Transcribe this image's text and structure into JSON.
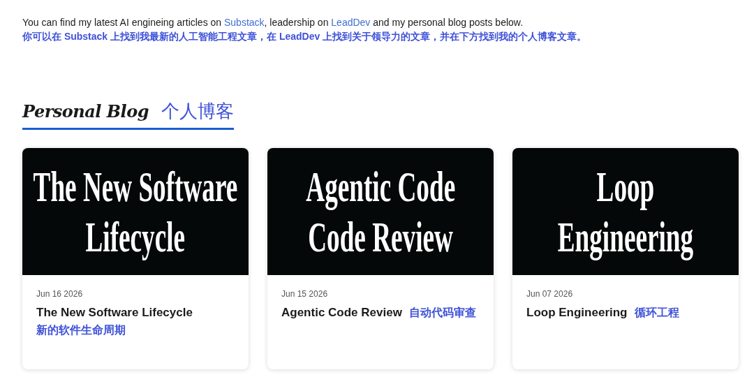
{
  "intro": {
    "parts": [
      {
        "text": "You can find my latest AI engineing articles on ",
        "link": false
      },
      {
        "text": "Substack",
        "link": true
      },
      {
        "text": ", leadership on ",
        "link": false
      },
      {
        "text": "LeadDev",
        "link": true
      },
      {
        "text": " and my personal blog posts below.",
        "link": false
      }
    ],
    "translation": "你可以在 Substack 上找到我最新的人工智能工程文章，在 LeadDev 上找到关于领导力的文章，并在下方找到我的个人博客文章。"
  },
  "section": {
    "title": "Personal Blog",
    "title_zh": "个人博客"
  },
  "posts": [
    {
      "cover_lines": [
        "The New Software",
        "Lifecycle"
      ],
      "date": "Jun 16 2026",
      "title": "The New Software Lifecycle",
      "title_zh": "新的软件生命周期"
    },
    {
      "cover_lines": [
        "Agentic Code",
        "Code Review"
      ],
      "date": "Jun 15 2026",
      "title": "Agentic Code Review",
      "title_zh": "自动代码审查"
    },
    {
      "cover_lines": [
        "Loop",
        "Engineering"
      ],
      "date": "Jun 07 2026",
      "title": "Loop Engineering",
      "title_zh": "循环工程"
    }
  ]
}
